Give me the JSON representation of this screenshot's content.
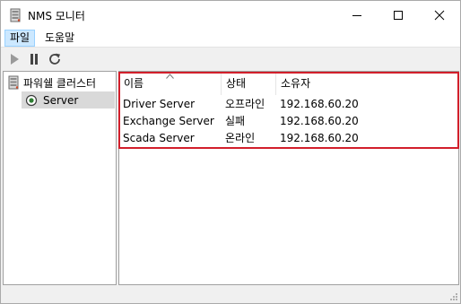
{
  "window": {
    "title": "NMS 모니터",
    "icon": "server-rack-icon",
    "controls": [
      "minimize-icon",
      "maximize-icon",
      "close-icon"
    ]
  },
  "menu": {
    "items": [
      {
        "label": "파일",
        "active": true
      },
      {
        "label": "도움말",
        "active": false
      }
    ]
  },
  "toolbar": {
    "buttons": [
      "play-icon",
      "pause-icon",
      "refresh-icon"
    ]
  },
  "tree": {
    "root": {
      "label": "파워쉘 클러스터",
      "icon": "server-rack-icon"
    },
    "children": [
      {
        "label": "Server",
        "icon": "radio-node-icon",
        "selected": true
      }
    ]
  },
  "list": {
    "columns": [
      "이름",
      "상태",
      "소유자"
    ],
    "sorted_column": "이름",
    "rows": [
      {
        "name": "Driver Server",
        "status": "오프라인",
        "owner": "192.168.60.20"
      },
      {
        "name": "Exchange Server",
        "status": "실패",
        "owner": "192.168.60.20"
      },
      {
        "name": "Scada Server",
        "status": "온라인",
        "owner": "192.168.60.20"
      }
    ]
  },
  "colors": {
    "highlight_border": "#d21f2b",
    "menu_active_bg": "#cce8ff",
    "tree_selected_bg": "#d9d9d9"
  }
}
